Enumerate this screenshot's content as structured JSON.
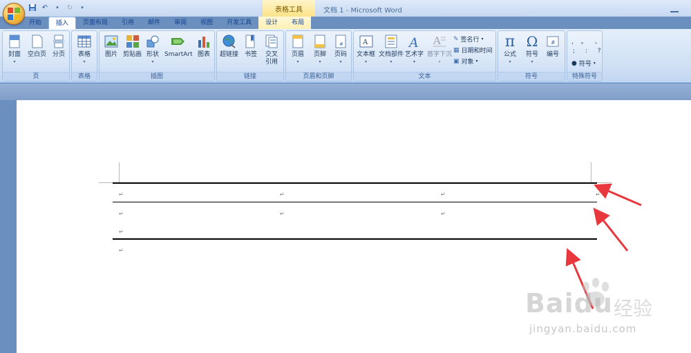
{
  "titlebar": {
    "context_tool": "表格工具",
    "doc_title": "文档 1 - Microsoft Word"
  },
  "tabs": [
    {
      "label": "开始"
    },
    {
      "label": "插入",
      "active": true
    },
    {
      "label": "页面布局"
    },
    {
      "label": "引用"
    },
    {
      "label": "邮件"
    },
    {
      "label": "审阅"
    },
    {
      "label": "视图"
    },
    {
      "label": "开发工具"
    },
    {
      "label": "设计",
      "contextual": true
    },
    {
      "label": "布局",
      "contextual": true
    }
  ],
  "groups": {
    "pages": {
      "label": "页",
      "items": [
        "封面",
        "空白页",
        "分页"
      ]
    },
    "tables": {
      "label": "表格",
      "items": [
        "表格"
      ]
    },
    "illustrations": {
      "label": "插图",
      "items": [
        "图片",
        "剪贴画",
        "形状",
        "SmartArt",
        "图表"
      ]
    },
    "links": {
      "label": "链接",
      "items": [
        "超链接",
        "书签",
        "交叉",
        "引用"
      ]
    },
    "header_footer": {
      "label": "页眉和页脚",
      "items": [
        "页眉",
        "页脚",
        "页码"
      ]
    },
    "text": {
      "label": "文本",
      "items": [
        "文本框",
        "文档部件",
        "艺术字",
        "首字下沉"
      ],
      "small": [
        "签名行",
        "日期和时间",
        "对象"
      ]
    },
    "symbols": {
      "label": "符号",
      "items": [
        "公式",
        "符号",
        "编号"
      ]
    },
    "special": {
      "label": "特殊符号",
      "symbols_row1": ", 。 、",
      "symbols_row2": "; : ?",
      "dropdown": "符号"
    }
  },
  "document": {
    "para_mark": "↵"
  },
  "watermark": {
    "brand": "Baidu",
    "cn": "经验",
    "url": "jingyan.baidu.com"
  },
  "colors": {
    "accent": "#e8383d",
    "ribbon": "#cfe0f5",
    "frame": "#6b8fbf"
  }
}
